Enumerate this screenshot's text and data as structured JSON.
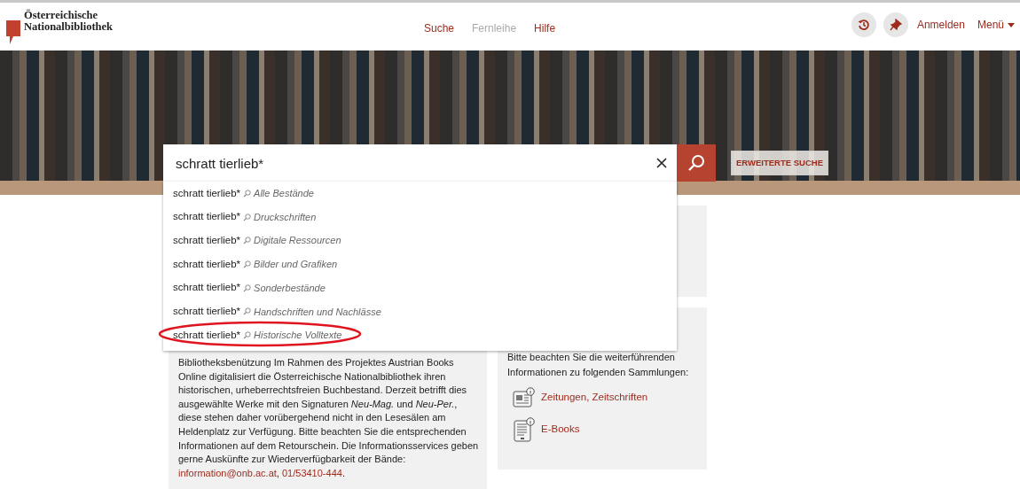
{
  "header": {
    "logo_lines": [
      "Österreichische",
      "Nationalbibliothek"
    ],
    "nav": [
      {
        "label": "Suche",
        "disabled": false
      },
      {
        "label": "Fernleihe",
        "disabled": true
      },
      {
        "label": "Hilfe",
        "disabled": false
      }
    ],
    "login": "Anmelden",
    "menu": "Menü"
  },
  "search": {
    "value": "schratt tierlieb*",
    "advanced": "ERWEITERTE SUCHE",
    "suggestions": [
      {
        "query": "schratt tierlieb*",
        "scope": "Alle Bestände",
        "circled": false
      },
      {
        "query": "schratt tierlieb*",
        "scope": "Druckschriften",
        "circled": false
      },
      {
        "query": "schratt tierlieb*",
        "scope": "Digitale Ressourcen",
        "circled": false
      },
      {
        "query": "schratt tierlieb*",
        "scope": "Bilder und Grafiken",
        "circled": false
      },
      {
        "query": "schratt tierlieb*",
        "scope": "Sonderbestände",
        "circled": false
      },
      {
        "query": "schratt tierlieb*",
        "scope": "Handschriften und Nachlässe",
        "circled": false
      },
      {
        "query": "schratt tierlieb*",
        "scope": "Historische Volltexte",
        "circled": true
      }
    ]
  },
  "left_panel": {
    "segments": [
      {
        "kind": "text",
        "text": "Bibliotheksbenützung Im Rahmen des Projektes Austrian Books Online digitalisiert die Österreichische Nationalbibliothek ihren historischen, urheberrechtsfreien Buchbestand. Derzeit betrifft dies ausgewählte Werke mit den Signaturen *Neu-Mag.* und *Neu-Per.*, diese stehen daher vorübergehend nicht in den Lesesälen am Heldenplatz zur Verfügung. Bitte beachten Sie die entsprechenden Informationen auf dem Retourschein. Die Informationsservices geben gerne Auskünfte zur Wiederverfügbarkeit der Bände: "
      },
      {
        "kind": "link",
        "text": "information@onb.ac.at"
      },
      {
        "kind": "text",
        "text": ", "
      },
      {
        "kind": "link",
        "text": "01/53410-444"
      },
      {
        "kind": "text",
        "text": "."
      }
    ]
  },
  "right_panel": {
    "intro": "Bitte beachten Sie die weiterführenden Informationen zu folgenden Sammlungen:",
    "links": [
      {
        "label": "Zeitungen, Zeitschriften",
        "kind": "newspaper"
      },
      {
        "label": "E-Books",
        "kind": "ebook"
      }
    ]
  }
}
